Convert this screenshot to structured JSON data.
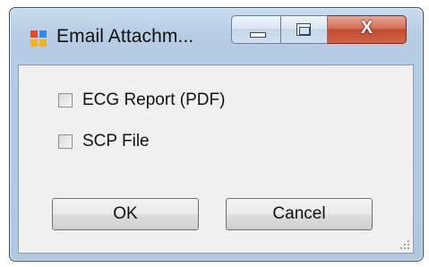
{
  "window": {
    "title": "Email Attachm...",
    "icon": "application-icon",
    "controls": {
      "minimize_icon": "minimize-icon",
      "maximize_icon": "maximize-icon",
      "close_label": "X"
    }
  },
  "options": [
    {
      "label": "ECG Report (PDF)",
      "checked": false
    },
    {
      "label": "SCP File",
      "checked": false
    }
  ],
  "buttons": {
    "ok_label": "OK",
    "cancel_label": "Cancel"
  },
  "colors": {
    "titlebar": "#b7cde4",
    "close_button": "#c24a30",
    "client": "#f0f0f0"
  }
}
